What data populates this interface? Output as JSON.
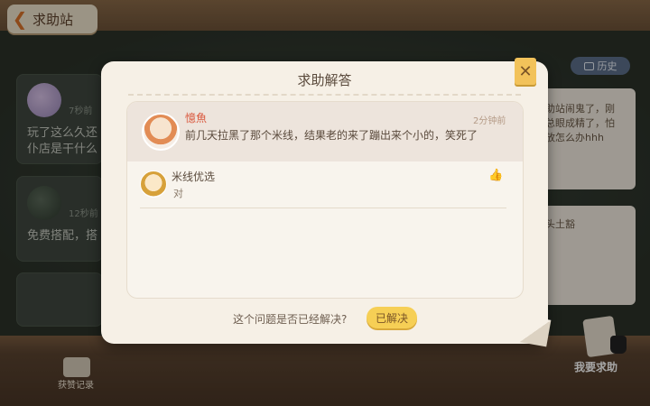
{
  "header": {
    "back_label": "求助站",
    "back_icon": "chevron-left-icon"
  },
  "history": {
    "label": "历史"
  },
  "background": {
    "cards": [
      {
        "time": "7秒前",
        "line1": "玩了这么久还",
        "line2": "仆店是干什么"
      },
      {
        "time": "12秒前",
        "line1": "免费搭配，搭"
      }
    ],
    "notes": [
      {
        "line1": "助站闹鬼了，刚",
        "line2": "总眼成精了，怕",
        "line3": "放怎么办hhh"
      },
      {
        "line1": "头土豁"
      }
    ]
  },
  "bottom": {
    "record_label": "获赞记录",
    "help_label": "我要求助"
  },
  "modal": {
    "title": "求助解答",
    "close_icon": "close-icon",
    "post": {
      "name": "憶魚",
      "time": "2分钟前",
      "text": "前几天拉黑了那个米线，结果老的来了蹦出来个小的，笑死了"
    },
    "replies": [
      {
        "name": "米线优选",
        "text": "对"
      }
    ],
    "question": "这个问题是否已经解决?",
    "resolved_label": "已解决"
  },
  "colors": {
    "accent": "#f6cf55",
    "name_red": "#d9563b",
    "history_blue": "#5d6f8a"
  }
}
